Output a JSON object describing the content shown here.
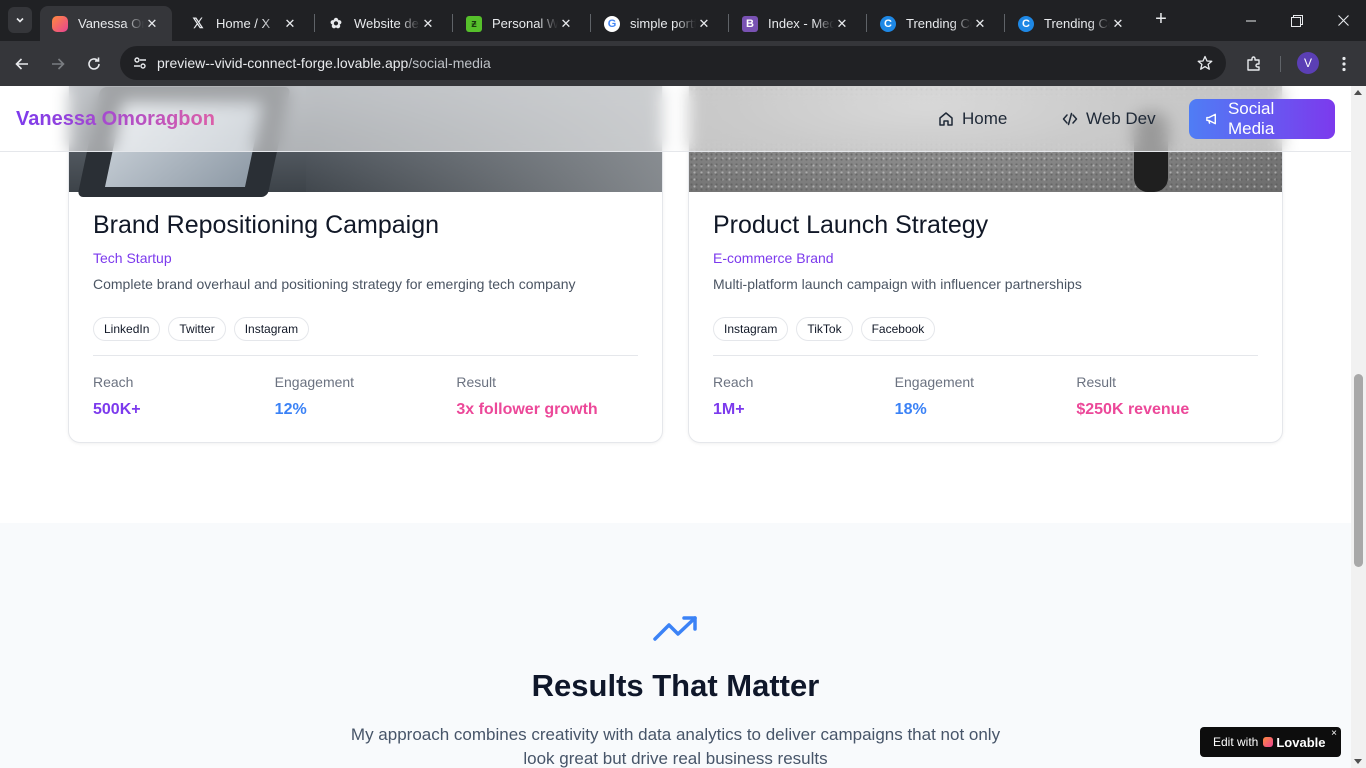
{
  "browser": {
    "tabs": [
      {
        "title": "Vanessa Omoragbon",
        "active": true,
        "favicon": "lovable-heart-icon",
        "favicon_color": "#e84393"
      },
      {
        "title": "Home / X",
        "favicon": "x-logo-icon",
        "favicon_color": "#000000"
      },
      {
        "title": "Website design ideas",
        "favicon": "openai-icon",
        "favicon_color": "#ffffff"
      },
      {
        "title": "Personal Website",
        "favicon": "framer-icon",
        "favicon_color": "#56c02b"
      },
      {
        "title": "simple portfolio",
        "favicon": "google-icon",
        "favicon_color": "#4285f4"
      },
      {
        "title": "Index - Medium",
        "favicon": "bootstrap-icon",
        "favicon_color": "#7952b3"
      },
      {
        "title": "Trending Colors",
        "favicon": "coolors-icon",
        "favicon_color": "#1e88e5"
      },
      {
        "title": "Trending Colors",
        "favicon": "coolors-icon",
        "favicon_color": "#1e88e5"
      }
    ],
    "new_tab_label": "+",
    "url_host": "preview--vivid-connect-forge.lovable.app",
    "url_path": "/social-media",
    "profile_initial": "V"
  },
  "nav": {
    "brand": "Vanessa Omoragbon",
    "items": [
      {
        "label": "Home",
        "icon": "home-icon"
      },
      {
        "label": "Web Dev",
        "icon": "code-icon"
      },
      {
        "label": "Social Media",
        "icon": "megaphone-icon",
        "active": true
      }
    ]
  },
  "projects": [
    {
      "title": "Brand Repositioning Campaign",
      "client": "Tech Startup",
      "description": "Complete brand overhaul and positioning strategy for emerging tech company",
      "tags": [
        "LinkedIn",
        "Twitter",
        "Instagram"
      ],
      "stats": [
        {
          "label": "Reach",
          "value": "500K+",
          "color": "#7c3aed"
        },
        {
          "label": "Engagement",
          "value": "12%",
          "color": "#3b82f6"
        },
        {
          "label": "Result",
          "value": "3x follower growth",
          "color": "#ec4899"
        }
      ]
    },
    {
      "title": "Product Launch Strategy",
      "client": "E-commerce Brand",
      "description": "Multi-platform launch campaign with influencer partnerships",
      "tags": [
        "Instagram",
        "TikTok",
        "Facebook"
      ],
      "stats": [
        {
          "label": "Reach",
          "value": "1M+",
          "color": "#7c3aed"
        },
        {
          "label": "Engagement",
          "value": "18%",
          "color": "#3b82f6"
        },
        {
          "label": "Result",
          "value": "$250K revenue",
          "color": "#ec4899"
        }
      ]
    }
  ],
  "results": {
    "icon": "trending-up-icon",
    "title": "Results That Matter",
    "description": "My approach combines creativity with data analytics to deliver campaigns that not only look great but drive real business results"
  },
  "badge": {
    "prefix": "Edit with",
    "brand": "Lovable",
    "close": "×"
  },
  "colors": {
    "accent_purple": "#7c3aed",
    "accent_blue": "#3b82f6",
    "accent_pink": "#ec4899"
  }
}
